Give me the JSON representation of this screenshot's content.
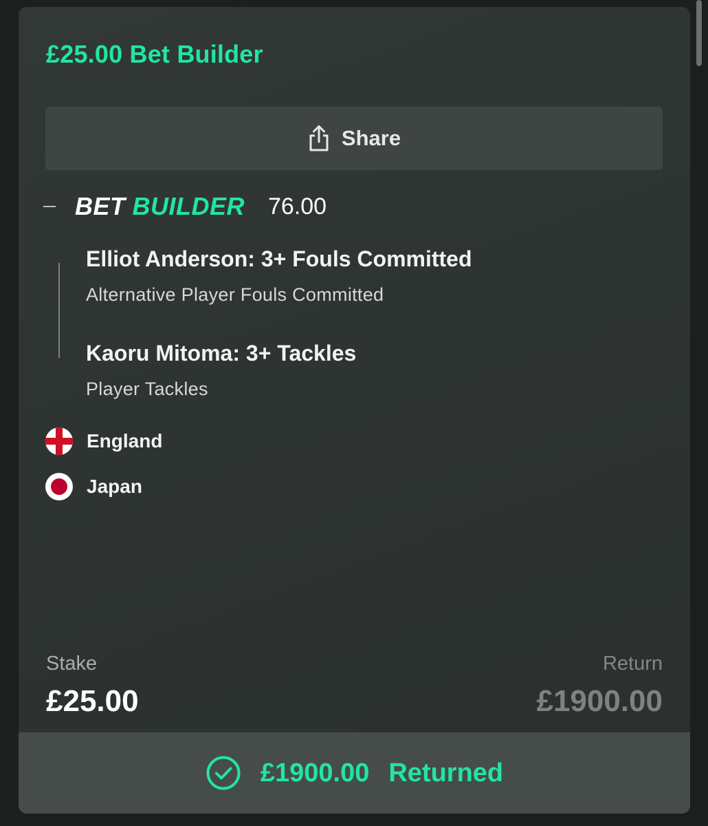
{
  "bet": {
    "title": "£25.00 Bet Builder",
    "share_label": "Share",
    "builder": {
      "logo_bet": "BET",
      "logo_builder": "BUILDER",
      "odds": "76.00"
    },
    "legs": [
      {
        "title": "Elliot Anderson: 3+ Fouls Committed",
        "market": "Alternative Player Fouls Committed"
      },
      {
        "title": "Kaoru Mitoma: 3+ Tackles",
        "market": "Player Tackles"
      }
    ],
    "teams": [
      {
        "name": "England",
        "flag_icon": "england-flag-icon"
      },
      {
        "name": "Japan",
        "flag_icon": "japan-flag-icon"
      }
    ],
    "stake_label": "Stake",
    "stake_value": "£25.00",
    "return_label": "Return",
    "return_value": "£1900.00",
    "returned_amount": "£1900.00",
    "returned_label": "Returned"
  },
  "colors": {
    "accent": "#21e6a0",
    "card_bg": "#2f3533",
    "page_bg": "#1c1f1e"
  }
}
